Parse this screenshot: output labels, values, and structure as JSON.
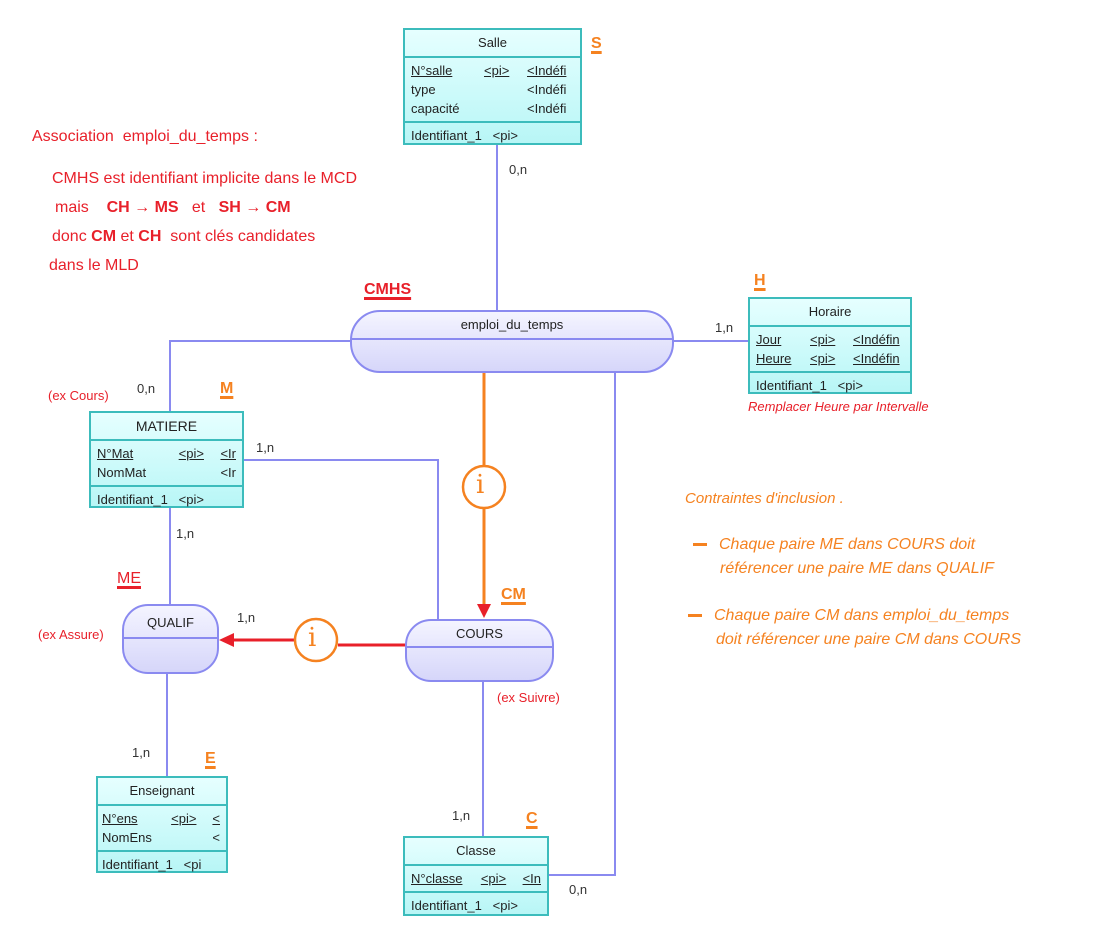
{
  "notes": {
    "line1a": "Association",
    "line1b": "emploi_du_temps :",
    "line2": "CMHS  est identifiant implicite dans le MCD",
    "line3": {
      "w1": "mais",
      "a": "CH → MS",
      "w2": "et",
      "b": "SH → CM"
    },
    "line4": {
      "w1": "donc",
      "a": "CM",
      "w2": "et",
      "b": "CH",
      "w3": "sont clés candidates"
    },
    "line5": "dans le MLD"
  },
  "entities": {
    "salle": {
      "title": "Salle",
      "label": "S",
      "attrs": [
        [
          "N°salle",
          "<pi>",
          "<Indéfi"
        ],
        [
          "type",
          "",
          "<Indéfi"
        ],
        [
          "capacité",
          "",
          "<Indéfi"
        ]
      ],
      "id": "Identifiant_1   <pi>"
    },
    "horaire": {
      "title": "Horaire",
      "label": "H",
      "attrs": [
        [
          "Jour",
          "<pi>",
          "<Indéfin"
        ],
        [
          "Heure",
          "<pi>",
          "<Indéfin"
        ]
      ],
      "id": "Identifiant_1   <pi>",
      "note": "Remplacer Heure par Intervalle"
    },
    "matiere": {
      "title": "MATIERE",
      "label": "M",
      "note": "(ex Cours)",
      "attrs": [
        [
          "N°Mat",
          "<pi>",
          "<Ir"
        ],
        [
          "NomMat",
          "",
          "<Ir"
        ]
      ],
      "id": "Identifiant_1   <pi>"
    },
    "enseignant": {
      "title": "Enseignant",
      "label": "E",
      "attrs": [
        [
          "N°ens",
          "<pi>",
          "<"
        ],
        [
          "NomEns",
          "",
          "<"
        ]
      ],
      "id": "Identifiant_1   <pi"
    },
    "classe": {
      "title": "Classe",
      "label": "C",
      "attrs": [
        [
          "N°classe",
          "<pi>",
          "<In"
        ]
      ],
      "id": "Identifiant_1   <pi>"
    }
  },
  "associations": {
    "emploi": {
      "title": "emploi_du_temps",
      "label": "CMHS"
    },
    "cours": {
      "title": "COURS",
      "label": "CM",
      "note": "(ex Suivre)"
    },
    "qualif": {
      "title": "QUALIF",
      "label": "ME",
      "note": "(ex Assure)"
    }
  },
  "cardinalities": {
    "salle": "0,n",
    "horaire": "1,n",
    "matiere_emploi": "0,n",
    "matiere_cours": "1,n",
    "matiere_qualif": "1,n",
    "qualif_cours": "1,n",
    "qualif_ens": "1,n",
    "cours_classe": "1,n",
    "emploi_classe": "0,n"
  },
  "inclusion": {
    "symbol": "i",
    "title": "Contraintes d'inclusion .",
    "c1a": "Chaque paire ME dans COURS doit",
    "c1b": "référencer une paire ME dans QUALIF",
    "c2a": "Chaque paire CM dans emploi_du_temps",
    "c2b": "doit référencer une paire CM dans COURS"
  },
  "colors": {
    "red": "#e8202a",
    "orange": "#f58220",
    "entity": "#3cbcbc",
    "association": "#8a8af0"
  }
}
